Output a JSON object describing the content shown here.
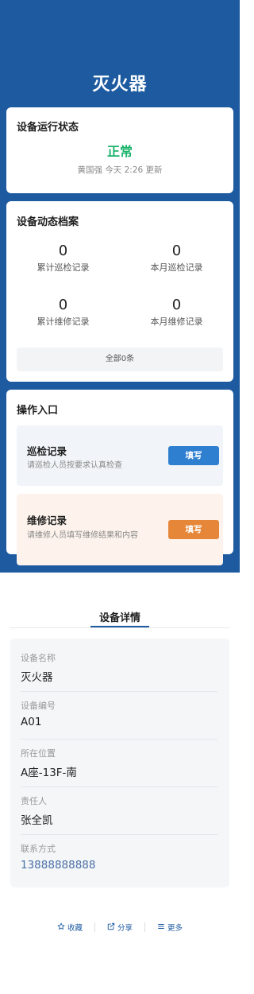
{
  "title": "灭火器",
  "status_card": {
    "heading": "设备运行状态",
    "value": "正常",
    "meta": "黄国强 今天 2:26 更新"
  },
  "archive_card": {
    "heading": "设备动态档案",
    "stats": [
      {
        "value": "0",
        "label": "累计巡检记录"
      },
      {
        "value": "0",
        "label": "本月巡检记录"
      },
      {
        "value": "0",
        "label": "累计维修记录"
      },
      {
        "value": "0",
        "label": "本月维修记录"
      }
    ],
    "all_label": "全部0条"
  },
  "ops_card": {
    "heading": "操作入口",
    "patrol": {
      "title": "巡检记录",
      "desc": "请巡检人员按要求认真检查",
      "button": "填写"
    },
    "repair": {
      "title": "维修记录",
      "desc": "请维修人员填写维修结果和内容",
      "button": "填写"
    }
  },
  "details": {
    "tab": "设备详情",
    "fields": [
      {
        "label": "设备名称",
        "value": "灭火器"
      },
      {
        "label": "设备编号",
        "value": "A01"
      },
      {
        "label": "所在位置",
        "value": "A座-13F-南"
      },
      {
        "label": "责任人",
        "value": "张全凯"
      },
      {
        "label": "联系方式",
        "value": "13888888888"
      }
    ]
  },
  "footer": {
    "favorite": "收藏",
    "share": "分享",
    "more": "更多"
  },
  "colors": {
    "brand": "#1d5aa0",
    "status_ok": "#1bb36b",
    "patrol_button": "#2f7fd1",
    "repair_button": "#e68638"
  },
  "icons": [
    "star-icon",
    "share-icon",
    "menu-icon"
  ]
}
